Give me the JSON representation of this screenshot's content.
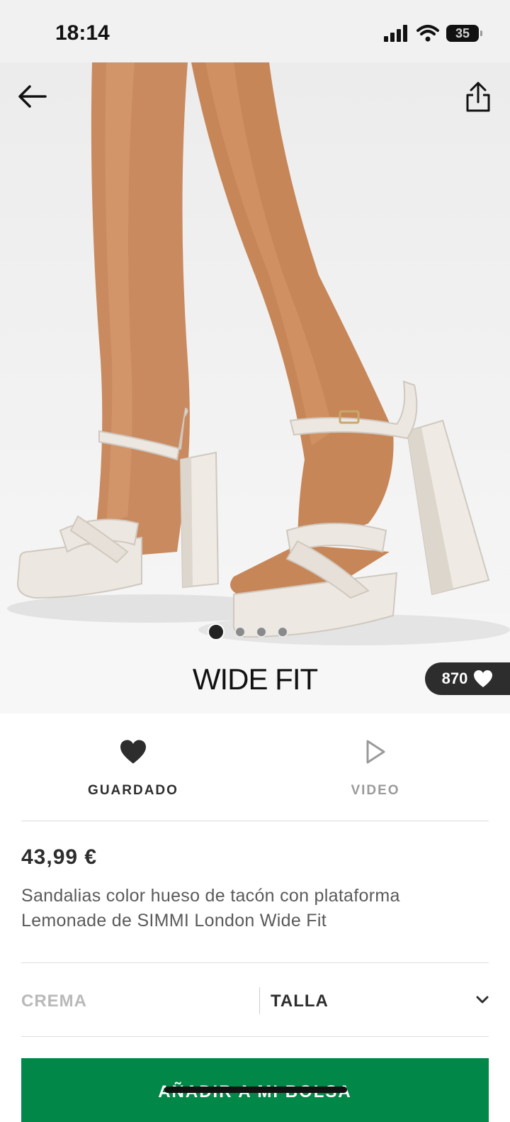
{
  "status_bar": {
    "time": "18:14",
    "battery": "35"
  },
  "product": {
    "fit_label": "WIDE FIT",
    "saved_count": "870",
    "price": "43,99 €",
    "description": "Sandalias color hueso de tacón con plataforma Lemonade de SIMMI London Wide Fit",
    "image_count": 4,
    "active_image": 1
  },
  "actions": {
    "saved_label": "GUARDADO",
    "video_label": "VIDEO"
  },
  "selectors": {
    "color": "CREMA",
    "size": "TALLA"
  },
  "cta": {
    "add_to_bag": "AÑADIR A MI BOLSA"
  },
  "colors": {
    "accent": "#018849",
    "dark": "#2d2d2d",
    "muted": "#9a9a9a"
  },
  "icons": [
    "back-arrow-icon",
    "share-icon",
    "heart-icon",
    "play-icon",
    "chevron-down-icon"
  ]
}
